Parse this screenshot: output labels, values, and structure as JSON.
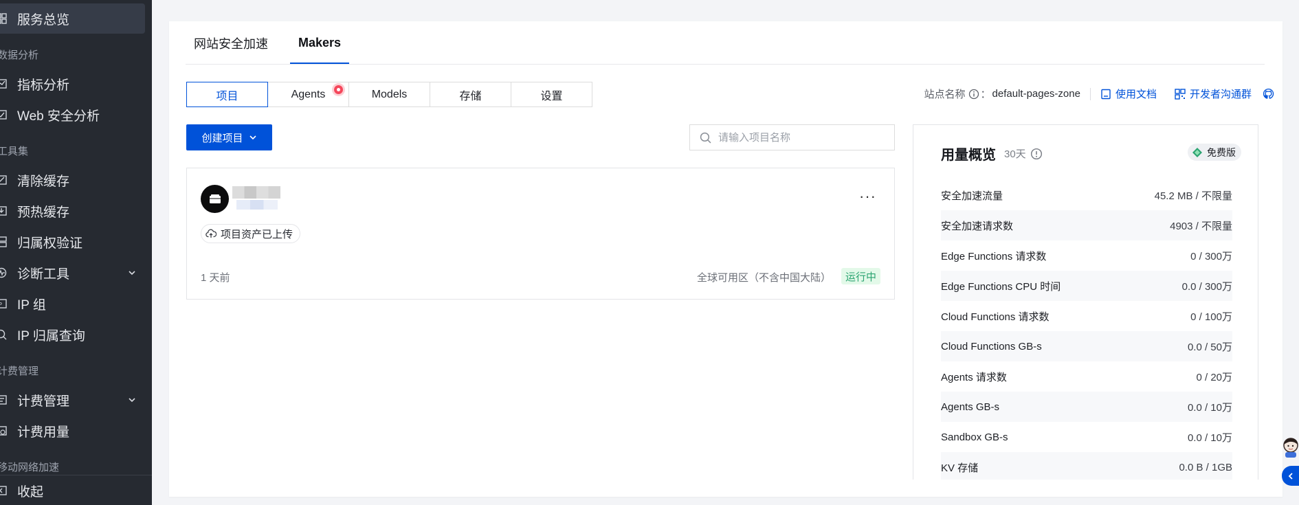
{
  "sidebar": {
    "items": [
      {
        "label": "服务总览"
      },
      {
        "label": "指标分析"
      },
      {
        "label": "Web 安全分析"
      },
      {
        "label": "清除缓存"
      },
      {
        "label": "预热缓存"
      },
      {
        "label": "归属权验证"
      },
      {
        "label": "诊断工具"
      },
      {
        "label": "IP 组"
      },
      {
        "label": "IP 归属查询"
      },
      {
        "label": "计费管理"
      },
      {
        "label": "计费用量"
      }
    ],
    "groups": [
      "数据分析",
      "工具集",
      "计费管理",
      "移动网络加速"
    ],
    "collapse_label": "收起"
  },
  "tabs": [
    {
      "label": "网站安全加速"
    },
    {
      "label": "Makers"
    }
  ],
  "segments": [
    {
      "label": "项目"
    },
    {
      "label": "Agents"
    },
    {
      "label": "Models"
    },
    {
      "label": "存储"
    },
    {
      "label": "设置"
    }
  ],
  "site": {
    "name_label": "站点名称",
    "colon": "：",
    "name_value": "default-pages-zone",
    "docs_link": "使用文档",
    "dev_group_link": "开发者沟通群"
  },
  "toolbar": {
    "create_label": "创建项目",
    "search_placeholder": "请输入项目名称"
  },
  "project": {
    "upload_tag": "项目资产已上传",
    "time": "1 天前",
    "region": "全球可用区（不含中国大陆）",
    "status": "运行中",
    "more": "···"
  },
  "usage": {
    "title": "用量概览",
    "range": "30天",
    "plan": "免费版",
    "rows": [
      {
        "name": "安全加速流量",
        "value": "45.2 MB / 不限量"
      },
      {
        "name": "安全加速请求数",
        "value": "4903 / 不限量"
      },
      {
        "name": "Edge Functions 请求数",
        "value": "0 / 300万"
      },
      {
        "name": "Edge Functions CPU 时间",
        "value": "0.0 / 300万"
      },
      {
        "name": "Cloud Functions 请求数",
        "value": "0 / 100万"
      },
      {
        "name": "Cloud Functions GB-s",
        "value": "0.0 / 50万"
      },
      {
        "name": "Agents 请求数",
        "value": "0 / 20万"
      },
      {
        "name": "Agents GB-s",
        "value": "0.0 / 10万"
      },
      {
        "name": "Sandbox GB-s",
        "value": "0.0 / 10万"
      },
      {
        "name": "KV 存储",
        "value": "0.0 B / 1GB"
      }
    ]
  },
  "colors": {
    "brand": "#0052d9",
    "sidebar_bg": "#262a31",
    "status_bg": "#e3f9e9",
    "status_text": "#2ba471",
    "notification": "#f5475b"
  }
}
